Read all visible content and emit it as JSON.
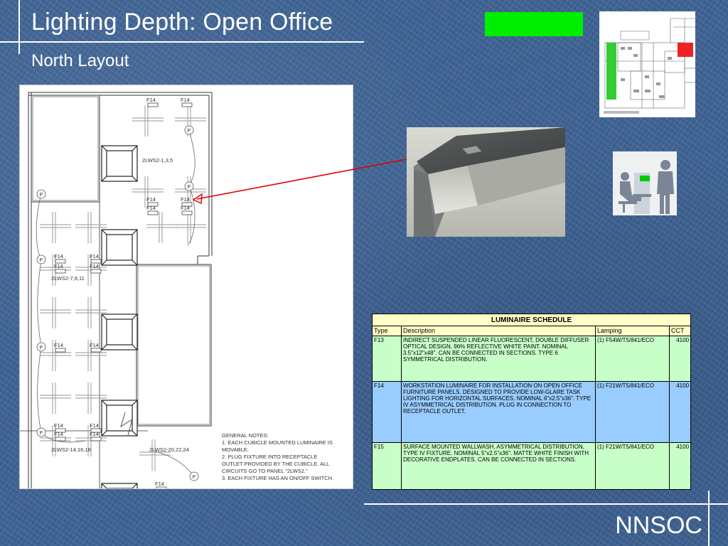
{
  "slide": {
    "title": "Lighting Depth:  Open Office",
    "subtitle": "North Layout",
    "footer": "NNSOC"
  },
  "colors": {
    "background": "#3f6496",
    "accent_green": "#00ee00",
    "schedule_header": "#ffffc8",
    "row_green": "#c8ffc8",
    "row_blue": "#99ccff",
    "arrow": "#e00000"
  },
  "plan": {
    "fixture_labels": [
      "F14",
      "F14",
      "F14",
      "F14",
      "F14",
      "F14",
      "F14",
      "F14",
      "F14",
      "F14",
      "F14",
      "F14",
      "F14",
      "F14",
      "F14",
      "F14",
      "F14"
    ],
    "circuit_labels": [
      "2LWS2-1,3,5",
      "2LWS2-7,9,11",
      "2LWS2-14,16,18",
      "2LWS2-20,22,24"
    ],
    "receptacle_symbol": "P",
    "notes_title": "GENERAL NOTES:",
    "notes": [
      "1.  EACH CUBICLE MOUNTED LUMINAIRE IS",
      "MOVABLE.",
      "2.  PLUG FIXTURE INTO RECEPTACLE",
      "OUTLET PROVIDED BY THE CUBICLE.  ALL",
      "CIRCUITS GO TO PANEL \"2LWS2.\"",
      "3.  EACH FIXTURE HAS AN ON/OFF SWITCH."
    ]
  },
  "schedule": {
    "caption": "LUMINAIRE SCHEDULE",
    "columns": [
      "Type",
      "Description",
      "Lamping",
      "CCT"
    ],
    "rows": [
      {
        "type": "F13",
        "description": "INDIRECT SUSPENDED LINEAR FLUORESCENT, DOUBLE DIFFUSER OPTICAL DESIGN, 96% REFLECTIVE WHITE PAINT. NOMINAL 3.5\"x12\"x48\".  CAN BE CONNECTED IN SECTIONS. TYPE 6 SYMMETRICAL DISTRIBUTION.",
        "lamping": "(1) F54W/T5/841/ECO",
        "cct": "4100"
      },
      {
        "type": "F14",
        "description": "WORKSTATION LUMINAIRE FOR INSTALLATION ON OPEN OFFICE FURNITURE PANELS.  DESIGNED TO PROVIDE LOW-GLARE TASK LIGHTING FOR HORIZONTAL SURFACES. NOMINAL 6\"x2.5\"x36\".  TYPE IV ASYMMETRICAL DISTRIBUTION. PLUG IN CONNECTION TO RECEPTACLE OUTLET.",
        "lamping": "(1) F21W/T5/841/ECO",
        "cct": "4100"
      },
      {
        "type": "F15",
        "description": "SURFACE MOUNTED WALLWASH, ASYMMETRICAL DISTRIBUTION, TYPE IV FIXTURE. NOMINAL 5\"x2.5\"x36\". MATTE WHITE FINISH WITH DECORATIVE ENDPLATES. CAN BE CONNECTED IN SECTIONS.",
        "lamping": "(1) F21W/T5/841/ECO",
        "cct": "4100"
      }
    ]
  }
}
